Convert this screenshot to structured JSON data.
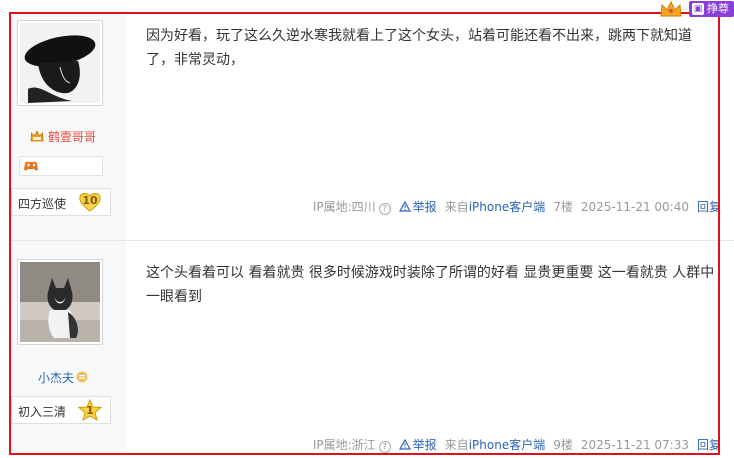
{
  "top_badges": {
    "vip_label": "挣尊"
  },
  "posts": [
    {
      "username": "鹤壹哥哥",
      "level_title": "四方巡使",
      "level_num": "10",
      "content": "因为好看，玩了这么久逆水寒我就看上了这个女头，站着可能还看不出来，跳两下就知道了，非常灵动，",
      "ip_label": "IP属地:四川",
      "report_label": "举报",
      "from_prefix": "来自",
      "from_client": "iPhone客户端",
      "floor": "7楼",
      "time": "2025-11-21 00:40",
      "reply_label": "回复"
    },
    {
      "username": "小杰夫",
      "level_title": "初入三清",
      "level_num": "1",
      "content": "这个头看着可以 看着就贵 很多时候游戏时装除了所谓的好看 显贵更重要 这一看就贵 人群中一眼看到",
      "ip_label": "IP属地:浙江",
      "report_label": "举报",
      "from_prefix": "来自",
      "from_client": "iPhone客户端",
      "floor": "9楼",
      "time": "2025-11-21 07:33",
      "reply_label": "回复"
    }
  ],
  "colors": {
    "accent_red": "#e0101c",
    "link_blue": "#2d64b3",
    "username_red": "#e04d3c",
    "vip_purple": "#8b3fd9"
  }
}
